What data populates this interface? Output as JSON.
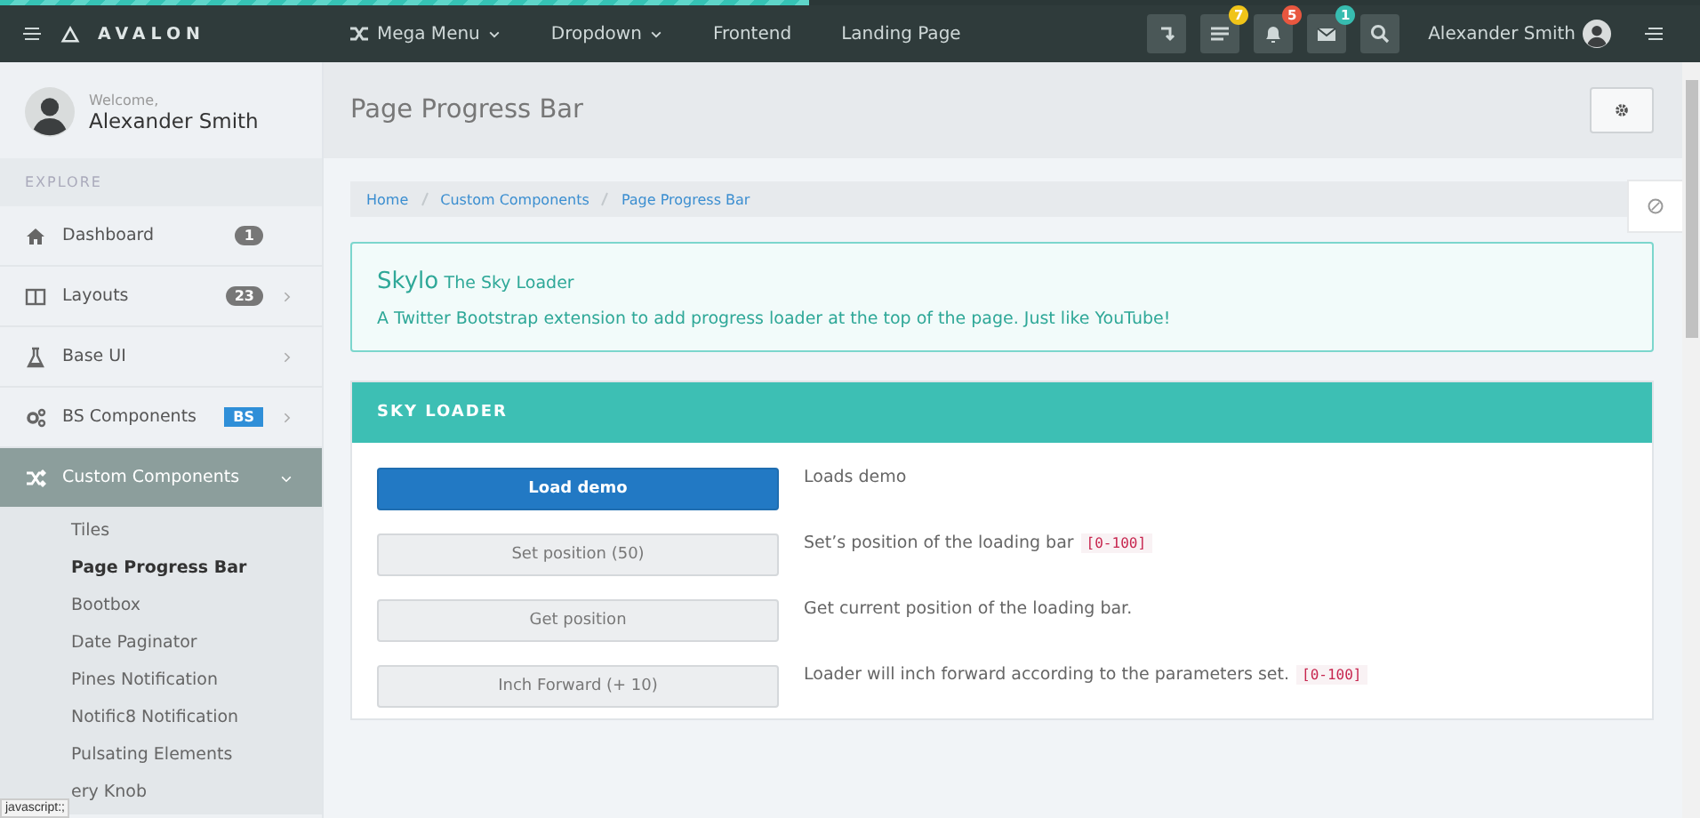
{
  "progress_bar": {
    "level": 0.476
  },
  "topbar": {
    "brand": "AVALON",
    "menu": [
      {
        "label": "Mega Menu",
        "kind": "dropdown"
      },
      {
        "label": "Dropdown",
        "kind": "dropdown"
      },
      {
        "label": "Frontend",
        "kind": "link"
      },
      {
        "label": "Landing Page",
        "kind": "link"
      }
    ],
    "tools": [
      {
        "kind": "return"
      },
      {
        "kind": "list",
        "badge": "7",
        "color": "#f0c419"
      },
      {
        "kind": "bell",
        "badge": "5",
        "color": "#e9573f"
      },
      {
        "kind": "mail",
        "badge": "1",
        "color": "#37bcb0"
      },
      {
        "kind": "search"
      }
    ],
    "user": "Alexander Smith"
  },
  "sidebar": {
    "welcome": "Welcome,",
    "user": "Alexander Smith",
    "section": "EXPLORE",
    "items": [
      {
        "label": "Dashboard",
        "badge": "1",
        "color": "#777777",
        "selected": false
      },
      {
        "label": "Layouts",
        "badge": "23",
        "color": "#777777",
        "expanded": false,
        "selected": false
      },
      {
        "label": "Base UI",
        "expanded": false,
        "selected": false
      },
      {
        "label": "BS Components",
        "badge": "BS",
        "color": "#2f8fd8",
        "expanded": false,
        "selected": false
      },
      {
        "label": "Custom Components",
        "selected": true,
        "expanded": true,
        "children": [
          {
            "label": "Tiles",
            "selected": false
          },
          {
            "label": "Page Progress Bar",
            "selected": true
          },
          {
            "label": "Bootbox",
            "selected": false
          },
          {
            "label": "Date Paginator",
            "selected": false
          },
          {
            "label": "Pines Notification",
            "selected": false
          },
          {
            "label": "Notific8 Notification",
            "selected": false
          },
          {
            "label": "Pulsating Elements",
            "selected": false
          },
          {
            "label": "ery Knob",
            "selected": false
          }
        ]
      }
    ]
  },
  "page": {
    "title": "Page Progress Bar",
    "breadcrumb": [
      "Home",
      "Custom Components",
      "Page Progress Bar"
    ],
    "alert": {
      "title": "Skylo",
      "subtitle": "The Sky Loader",
      "text": "A Twitter Bootstrap extension to add progress loader at the top of the page. Just like YouTube!"
    },
    "panel": {
      "title": "SKY LOADER",
      "rows": [
        {
          "button": "Load demo",
          "primary": true,
          "description": "Loads demo"
        },
        {
          "button": "Set position (50)",
          "primary": false,
          "description": "Set’s position of the loading bar",
          "code": "[0-100]"
        },
        {
          "button": "Get position",
          "primary": false,
          "description": "Get current position of the loading bar."
        },
        {
          "button": "Inch Forward (+ 10)",
          "primary": false,
          "description": "Loader will inch forward according to the parameters set.",
          "code": "[0-100]"
        }
      ]
    }
  },
  "status_bar": {
    "text": "javascript:;"
  }
}
